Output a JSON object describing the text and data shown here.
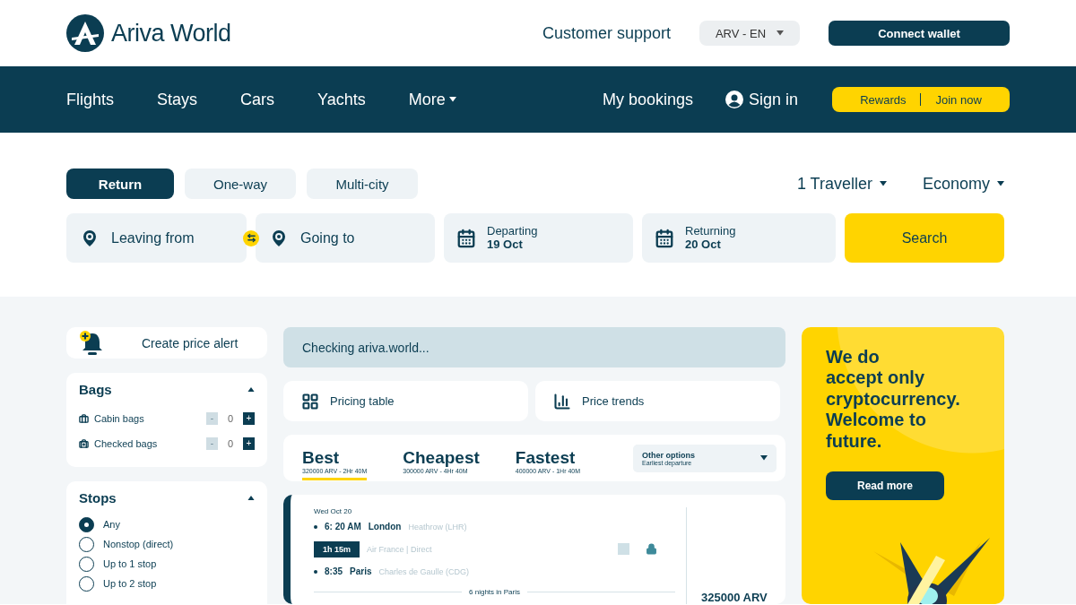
{
  "header": {
    "logo": "Ariva World",
    "support": "Customer support",
    "language": "ARV - EN",
    "connect": "Connect wallet"
  },
  "nav": {
    "links": [
      {
        "label": "Flights",
        "dropdown": false
      },
      {
        "label": "Stays",
        "dropdown": false
      },
      {
        "label": "Cars",
        "dropdown": false
      },
      {
        "label": "Yachts",
        "dropdown": false
      },
      {
        "label": "More",
        "dropdown": true
      }
    ],
    "bookings": "My bookings",
    "sign_in": "Sign in",
    "rewards": "Rewards",
    "join": "Join now"
  },
  "trip_types": [
    {
      "label": "Return",
      "selected": true
    },
    {
      "label": "One-way",
      "selected": false
    },
    {
      "label": "Multi-city",
      "selected": false
    }
  ],
  "travellers": "1 Traveller",
  "cabin": "Economy",
  "fields": [
    {
      "kind": "place",
      "label": "Leaving from"
    },
    {
      "kind": "place",
      "label": "Going to"
    },
    {
      "kind": "date",
      "label": "Departing",
      "value": "19 Oct"
    },
    {
      "kind": "date",
      "label": "Returning",
      "value": "20 Oct"
    }
  ],
  "search_button": "Search",
  "price_alert": "Create price alert",
  "bags": {
    "title": "Bags",
    "expanded": true,
    "items": [
      {
        "kind": "cabin",
        "label": "Cabin bags",
        "decrement": "-",
        "count": "0",
        "increment": "+"
      },
      {
        "kind": "checked",
        "label": "Checked bags",
        "decrement": "-",
        "count": "0",
        "increment": "+"
      }
    ]
  },
  "stops": {
    "title": "Stops",
    "expanded": true,
    "options": [
      {
        "label": "Any",
        "selected": true
      },
      {
        "label": "Nonstop (direct)",
        "selected": false
      },
      {
        "label": "Up to 1 stop",
        "selected": false
      },
      {
        "label": "Up to 2 stop",
        "selected": false
      }
    ]
  },
  "status": "Checking ariva.world...",
  "views": [
    {
      "kind": "table",
      "label": "Pricing table"
    },
    {
      "kind": "chart",
      "label": "Price trends"
    }
  ],
  "sort_tabs": [
    {
      "title": "Best",
      "detail": "320000 ARV - 2Hr 40M",
      "selected": true
    },
    {
      "title": "Cheapest",
      "detail": "300000 ARV - 4Hr 40M",
      "selected": false
    },
    {
      "title": "Fastest",
      "detail": "400000 ARV - 1Hr 40M",
      "selected": false
    }
  ],
  "other_options": {
    "title": "Other options",
    "detail": "Earliest departure"
  },
  "flight": {
    "date": "Wed Oct 20",
    "depart": {
      "time": "6: 20 AM",
      "city": "London",
      "airport": "Heathrow (LHR)"
    },
    "duration": "1h 15m",
    "carrier": "Air France | Direct",
    "arrive": {
      "time": "8:35",
      "city": "Paris",
      "airport": "Charles de Gaulle (CDG)"
    },
    "stay": "6 nights in Paris",
    "compare_checked": false,
    "price": "325000 ARV"
  },
  "promo": {
    "lines": [
      "We do",
      "accept only",
      "cryptocurrency.",
      "Welcome to",
      "future."
    ],
    "button": "Read more"
  }
}
